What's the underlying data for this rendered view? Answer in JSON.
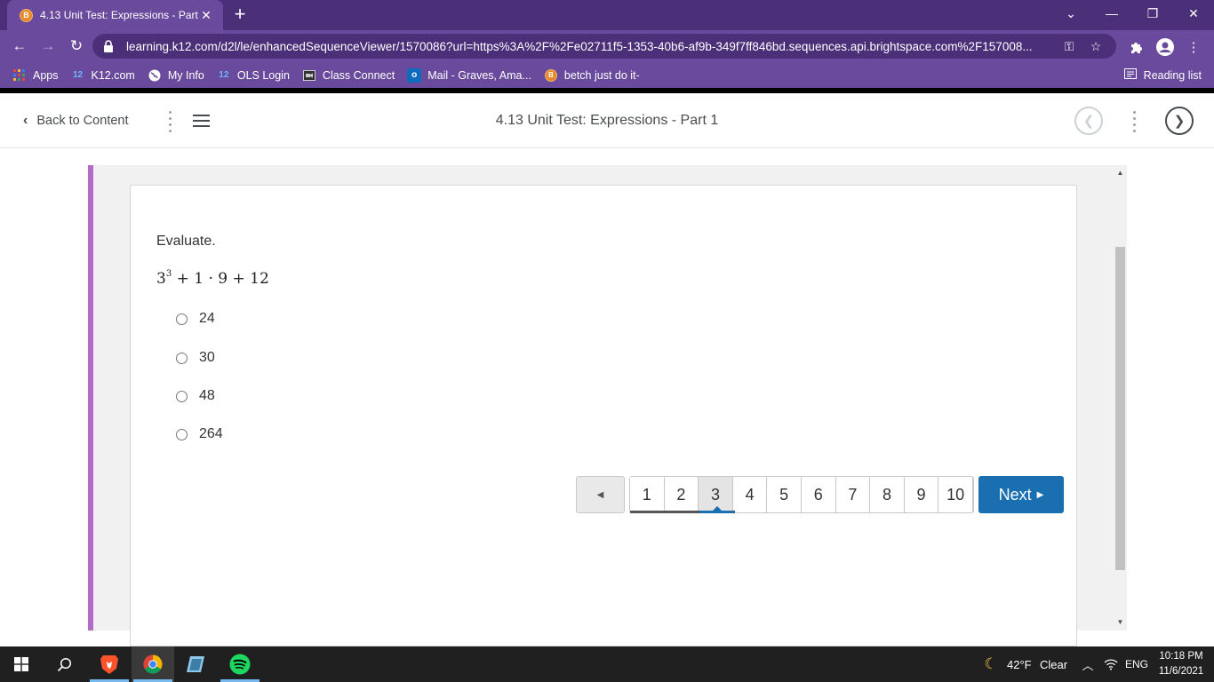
{
  "browser": {
    "tab_title": "4.13 Unit Test: Expressions - Part",
    "url": "learning.k12.com/d2l/le/enhancedSequenceViewer/1570086?url=https%3A%2F%2Fe02711f5-1353-40b6-af9b-349f7ff846bd.sequences.api.brightspace.com%2F157008...",
    "bookmarks": [
      {
        "label": "Apps",
        "icon": "apps-grid-icon"
      },
      {
        "label": "K12.com",
        "icon": "k12-icon"
      },
      {
        "label": "My Info",
        "icon": "globe-icon"
      },
      {
        "label": "OLS Login",
        "icon": "k12-icon"
      },
      {
        "label": "Class Connect",
        "icon": "video-icon"
      },
      {
        "label": "Mail - Graves, Ama...",
        "icon": "outlook-icon"
      },
      {
        "label": "betch just do it-",
        "icon": "brave-icon"
      }
    ],
    "reading_list": "Reading list"
  },
  "header": {
    "back_label": "Back to Content",
    "title": "4.13 Unit Test: Expressions - Part 1"
  },
  "question": {
    "prompt": "Evaluate.",
    "expression_base": "3",
    "expression_exp": "3",
    "expression_rest": "+ 1 · 9 + 12",
    "options": [
      "24",
      "30",
      "48",
      "264"
    ]
  },
  "pagination": {
    "pages": [
      "1",
      "2",
      "3",
      "4",
      "5",
      "6",
      "7",
      "8",
      "9",
      "10"
    ],
    "current": "3",
    "next_label": "Next"
  },
  "taskbar": {
    "weather_temp": "42°F",
    "weather_desc": "Clear",
    "language": "ENG",
    "time": "10:18 PM",
    "date": "11/6/2021"
  },
  "colors": {
    "chrome_purple": "#6a4a9c",
    "tabbar_purple": "#4b2f78",
    "accent_bar": "#b46ac8",
    "next_button": "#1a6fb0"
  }
}
